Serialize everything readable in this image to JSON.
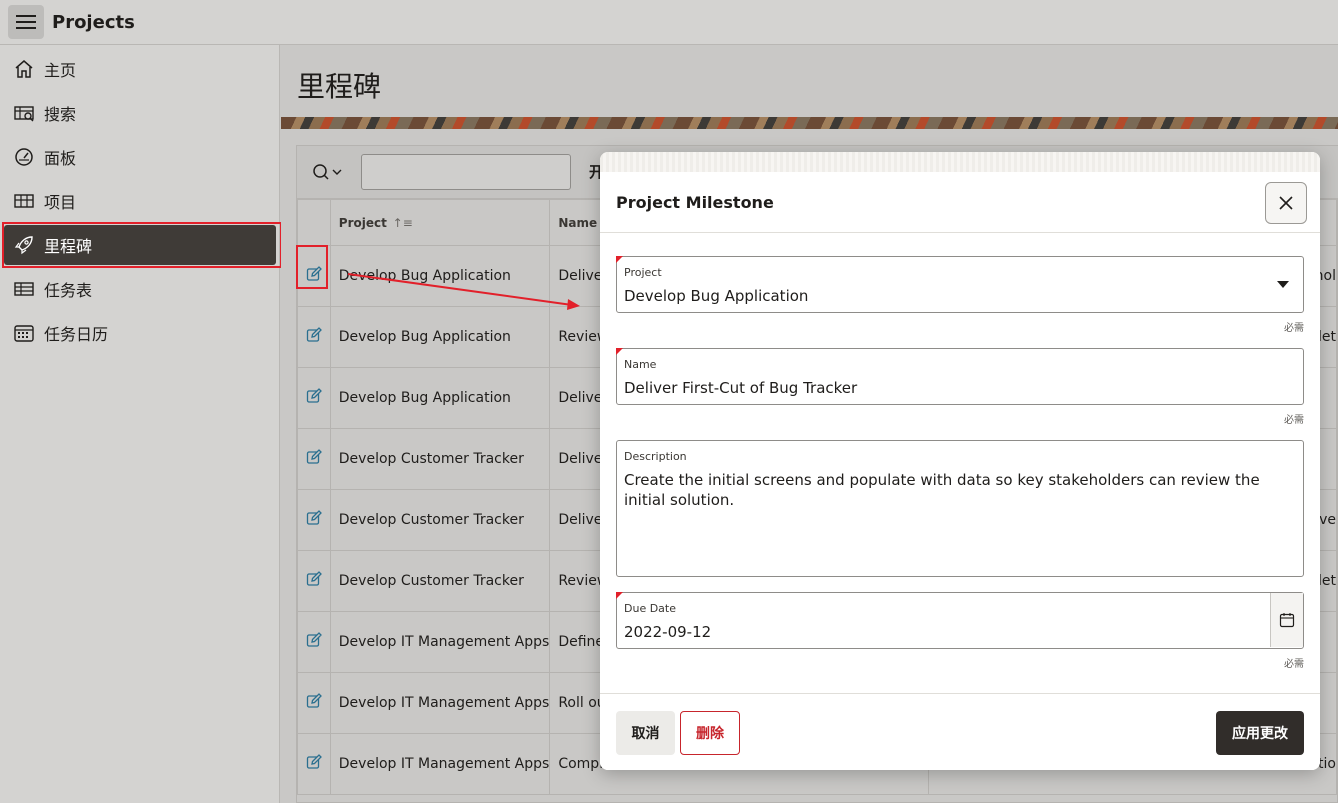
{
  "app": {
    "title": "Projects"
  },
  "sidebar": {
    "items": [
      {
        "label": "主页",
        "icon": "home-icon"
      },
      {
        "label": "搜索",
        "icon": "search-list-icon"
      },
      {
        "label": "面板",
        "icon": "dashboard-gauge-icon"
      },
      {
        "label": "项目",
        "icon": "grid-table-icon"
      },
      {
        "label": "里程碑",
        "icon": "rocket-icon",
        "active": true
      },
      {
        "label": "任务表",
        "icon": "table-icon"
      },
      {
        "label": "任务日历",
        "icon": "calendar-icon"
      }
    ]
  },
  "main": {
    "page_title": "里程碑",
    "toolbar": {
      "go_label": "开"
    },
    "table": {
      "headers": {
        "project": "Project",
        "name": "Name"
      },
      "rows": [
        {
          "project": "Develop Bug Application",
          "name": "Deliver",
          "rest": "nol"
        },
        {
          "project": "Develop Bug Application",
          "name": "Review",
          "rest": "det"
        },
        {
          "project": "Develop Bug Application",
          "name": "Deliver",
          "rest": ""
        },
        {
          "project": "Develop Customer Tracker",
          "name": "Deliver",
          "rest": ""
        },
        {
          "project": "Develop Customer Tracker",
          "name": "Deliver",
          "rest": "tive"
        },
        {
          "project": "Develop Customer Tracker",
          "name": "Review",
          "rest": "det"
        },
        {
          "project": "Develop IT Management Apps",
          "name": "Define",
          "rest": ""
        },
        {
          "project": "Develop IT Management Apps",
          "name": "Roll out",
          "rest": ""
        },
        {
          "project": "Develop IT Management Apps",
          "name": "Comple",
          "rest": "atio"
        }
      ]
    }
  },
  "dialog": {
    "title": "Project Milestone",
    "required_text": "必需",
    "fields": {
      "project": {
        "label": "Project",
        "value": "Develop Bug Application"
      },
      "name": {
        "label": "Name",
        "value": "Deliver First-Cut of Bug Tracker"
      },
      "description": {
        "label": "Description",
        "value": "Create the initial screens and populate with data so key stakeholders can review the initial solution."
      },
      "due_date": {
        "label": "Due Date",
        "value": "2022-09-12"
      }
    },
    "buttons": {
      "cancel": "取消",
      "delete": "删除",
      "apply": "应用更改"
    }
  },
  "colors": {
    "accent": "#e2202a",
    "active_nav": "#3f3b37",
    "primary_button": "#312d2a",
    "edit_icon": "#2a6f8f"
  }
}
